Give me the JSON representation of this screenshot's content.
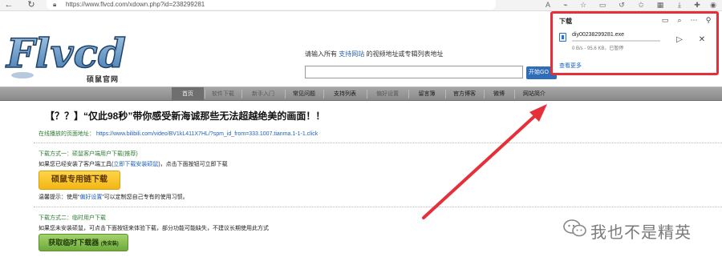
{
  "browser": {
    "back_icon": "back-arrow-icon",
    "refresh_icon": "refresh-icon",
    "lock_icon": "lock-icon",
    "url": "https://www.flvcd.com/xdown.php?id=238299281",
    "toolbar_icons": [
      "text-size-icon",
      "read-aloud-icon",
      "favorite-add-icon",
      "sidebar-icon",
      "refresh-circle-icon",
      "favorites-icon",
      "collections-icon",
      "downloads-icon",
      "extensions-icon",
      "profile-icon"
    ]
  },
  "site": {
    "logo_text": "Flvcd",
    "logo_subtitle": "硕鼠官网",
    "search_prompt_pre": "请输入所有",
    "search_prompt_link": "支持网站",
    "search_prompt_post": "的视频地址或专辑列表地址",
    "search_value": "",
    "search_button": "开始GO"
  },
  "menu": {
    "items": [
      {
        "label": "首页",
        "state": "active"
      },
      {
        "label": "软件下载",
        "state": "muted"
      },
      {
        "label": "新手入门",
        "state": "muted"
      },
      {
        "label": "常见问题",
        "state": "normal"
      },
      {
        "label": "支持列表",
        "state": "normal"
      },
      {
        "label": "偏好设置",
        "state": "muted"
      },
      {
        "label": "留言簿",
        "state": "normal"
      },
      {
        "label": "官方博客",
        "state": "normal"
      },
      {
        "label": "微博",
        "state": "normal"
      },
      {
        "label": "网站简介",
        "state": "normal"
      }
    ]
  },
  "content": {
    "title": "【？？】“仅此98秒”带你感受新海诚那些无法超越绝美的画面！！",
    "play_label": "在线播放的页面地址：",
    "play_url": "https://www.bilibili.com/video/BV1kL411X7HL/?spm_id_from=333.1007.tianma.1-1-1.click",
    "method1_title": "下载方式一：硕鼠客户端用户下载(推荐)",
    "method1_desc_pre": "如果您已经安装了客户端工具(",
    "method1_desc_link": "立即下载安装硕鼠",
    "method1_desc_post": ")，点击下面按钮可立即下载",
    "method1_button": "硕鼠专用链下载",
    "tip_pre": "温馨提示：使用“",
    "tip_link": "偏好设置",
    "tip_post": "”可以定制您自己专有的使用习惯。",
    "method2_title": "下载方式二：临时用户下载",
    "method2_desc": "如果您未安装硕鼠，可点击下面按钮来体验下载，部分功能可能缺失，不建议长期使用此方式",
    "method2_button": "获取临时下载器",
    "method2_button_note": "(免安装)"
  },
  "downloads_panel": {
    "title": "下载",
    "header_icons": [
      "folder-icon",
      "search-icon",
      "more-icon",
      "pin-icon"
    ],
    "file_name": "diy00238299281.exe",
    "status": "0 B/s - 95.6 KB，已暂停",
    "progress": 0.0,
    "more_link": "查看更多",
    "highlight_color": "#e5303a"
  },
  "watermark": {
    "text": "我也不是精英"
  }
}
